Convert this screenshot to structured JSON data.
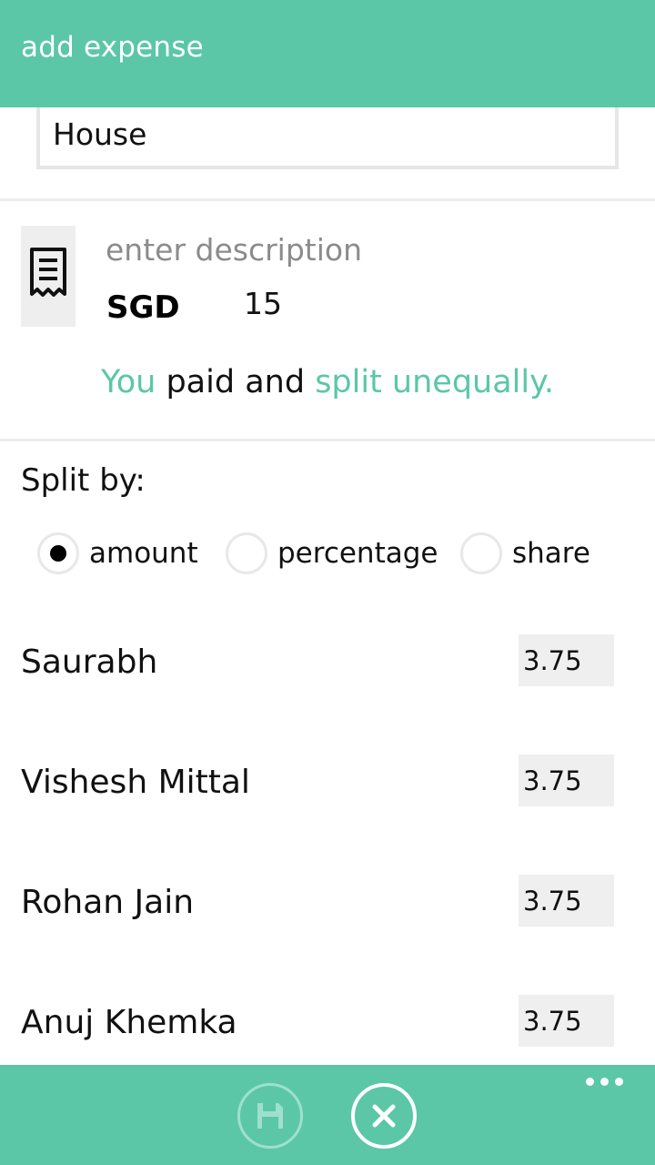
{
  "header": {
    "title": "add expense"
  },
  "group": {
    "value": "House"
  },
  "expense": {
    "receipt_icon": "receipt-icon",
    "description_placeholder": "enter description",
    "currency": "SGD",
    "amount": "15"
  },
  "summary": {
    "payer": "You",
    "paid_and": " paid and ",
    "split_mode": "split unequally."
  },
  "split": {
    "label": "Split by:",
    "selected": "amount",
    "options": [
      {
        "label": "amount"
      },
      {
        "label": "percentage"
      },
      {
        "label": "share"
      }
    ]
  },
  "members": [
    {
      "name": "Saurabh",
      "value": "3.75"
    },
    {
      "name": "Vishesh Mittal",
      "value": "3.75"
    },
    {
      "name": "Rohan Jain",
      "value": "3.75"
    },
    {
      "name": "Anuj Khemka",
      "value": "3.75"
    }
  ],
  "appbar": {
    "save_icon": "save-icon",
    "cancel_icon": "close-icon",
    "more_icon": "more-icon"
  },
  "colors": {
    "accent": "#5bc7a7",
    "bar": "#5bc7a7"
  }
}
